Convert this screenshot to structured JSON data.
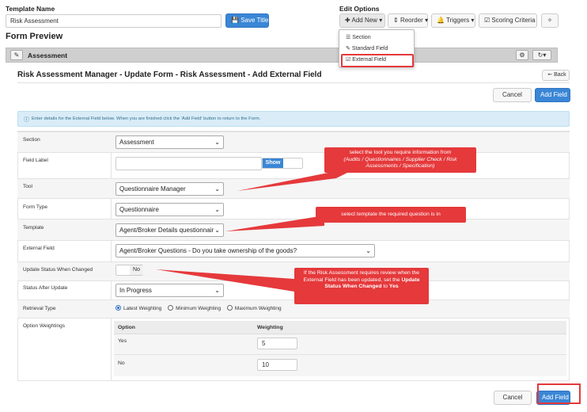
{
  "template": {
    "label": "Template Name",
    "value": "Risk Assessment",
    "save_title": "Save Title"
  },
  "edit_options": {
    "label": "Edit Options",
    "add_new": "Add New",
    "reorder": "Reorder",
    "triggers": "Triggers",
    "scoring": "Scoring Criteria",
    "menu": {
      "section": "Section",
      "standard_field": "Standard Field",
      "external_field": "External Field"
    }
  },
  "preview": {
    "title": "Form Preview",
    "section_name": "Assessment"
  },
  "page": {
    "title": "Risk Assessment Manager - Update Form - Risk Assessment - Add External Field",
    "back": "Back",
    "cancel": "Cancel",
    "add_field": "Add Field",
    "info": "Enter details for the External Field below. When you are finished click the 'Add Field' button to return to the Form."
  },
  "form": {
    "section": {
      "label": "Section",
      "value": "Assessment"
    },
    "field_label": {
      "label": "Field Label",
      "value": "",
      "show": "Show"
    },
    "tool": {
      "label": "Tool",
      "value": "Questionnaire Manager"
    },
    "form_type": {
      "label": "Form Type",
      "value": "Questionnaire"
    },
    "template": {
      "label": "Template",
      "value": "Agent/Broker Details questionnair"
    },
    "external_field": {
      "label": "External Field",
      "value": "Agent/Broker Questions - Do you take ownership of the goods?"
    },
    "update_status": {
      "label": "Update Status When Changed",
      "value": "No"
    },
    "status_after": {
      "label": "Status After Update",
      "value": "In Progress"
    },
    "retrieval": {
      "label": "Retrieval Type",
      "options": [
        "Latest Weighting",
        "Minimum Weighting",
        "Maximum Weighting"
      ],
      "selected": "Latest Weighting"
    },
    "weightings": {
      "label": "Option Weightings",
      "col_option": "Option",
      "col_weighting": "Weighting",
      "rows": [
        {
          "option": "Yes",
          "weighting": "5"
        },
        {
          "option": "No",
          "weighting": "10"
        }
      ]
    }
  },
  "callouts": {
    "tool_title": "select the tool you require information from",
    "tool_detail": "(Audits / Questionnaires / Supplier Check / Risk Assessments / Specification)",
    "template": "select template the required question is in",
    "status_pre": "If the Risk Assessment requires review when the External Field has been updated, set the",
    "status_bold": "Update Status When Changed",
    "status_mid": "to",
    "status_bold2": "Yes"
  },
  "colors": {
    "accent": "#3a86d6",
    "callout": "#e5393b",
    "highlight": "#e5393b",
    "info_bg": "#d9ecf7"
  }
}
